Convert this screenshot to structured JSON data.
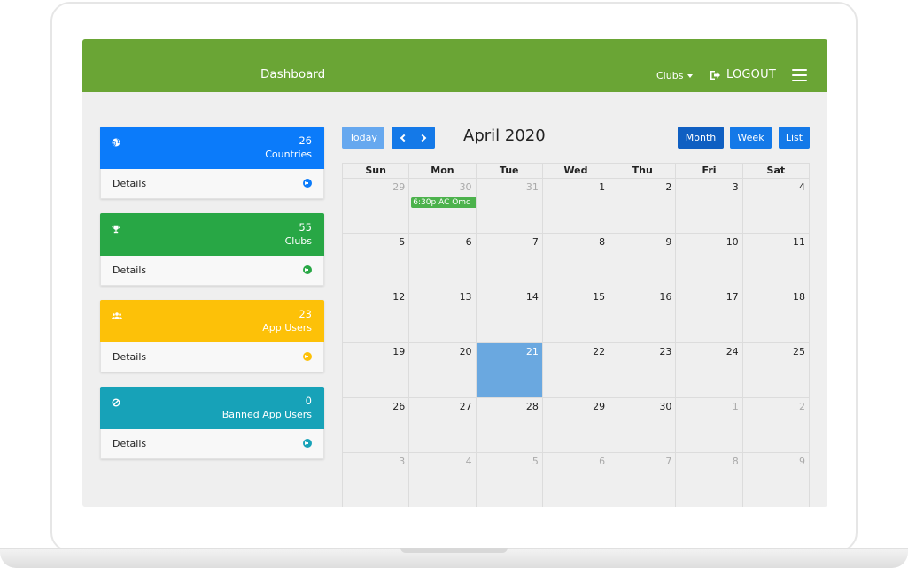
{
  "navbar": {
    "title": "Dashboard",
    "clubs_label": "Clubs",
    "logout_label": "LOGOUT",
    "color": "#6aa535"
  },
  "stats": [
    {
      "count": "26",
      "label": "Countries",
      "details": "Details",
      "icon": "globe-icon",
      "color": "#0b7bfa"
    },
    {
      "count": "55",
      "label": "Clubs",
      "details": "Details",
      "icon": "trophy-icon",
      "color": "#28a745"
    },
    {
      "count": "23",
      "label": "App Users",
      "details": "Details",
      "icon": "users-icon",
      "color": "#fdc108"
    },
    {
      "count": "0",
      "label": "Banned App Users",
      "details": "Details",
      "icon": "ban-icon",
      "color": "#17a2b8"
    }
  ],
  "calendar": {
    "today_label": "Today",
    "title": "April 2020",
    "views": {
      "month": "Month",
      "week": "Week",
      "list": "List"
    },
    "weekdays": [
      "Sun",
      "Mon",
      "Tue",
      "Wed",
      "Thu",
      "Fri",
      "Sat"
    ],
    "weeks": [
      [
        {
          "d": "29",
          "o": true
        },
        {
          "d": "30",
          "o": true
        },
        {
          "d": "31",
          "o": true
        },
        {
          "d": "1"
        },
        {
          "d": "2"
        },
        {
          "d": "3"
        },
        {
          "d": "4"
        }
      ],
      [
        {
          "d": "5"
        },
        {
          "d": "6"
        },
        {
          "d": "7"
        },
        {
          "d": "8"
        },
        {
          "d": "9"
        },
        {
          "d": "10"
        },
        {
          "d": "11"
        }
      ],
      [
        {
          "d": "12"
        },
        {
          "d": "13"
        },
        {
          "d": "14"
        },
        {
          "d": "15"
        },
        {
          "d": "16"
        },
        {
          "d": "17"
        },
        {
          "d": "18"
        }
      ],
      [
        {
          "d": "19"
        },
        {
          "d": "20"
        },
        {
          "d": "21",
          "today": true
        },
        {
          "d": "22"
        },
        {
          "d": "23"
        },
        {
          "d": "24"
        },
        {
          "d": "25"
        }
      ],
      [
        {
          "d": "26"
        },
        {
          "d": "27"
        },
        {
          "d": "28"
        },
        {
          "d": "29"
        },
        {
          "d": "30"
        },
        {
          "d": "1",
          "o": true
        },
        {
          "d": "2",
          "o": true
        }
      ],
      [
        {
          "d": "3",
          "o": true
        },
        {
          "d": "4",
          "o": true
        },
        {
          "d": "5",
          "o": true
        },
        {
          "d": "6",
          "o": true
        },
        {
          "d": "7",
          "o": true
        },
        {
          "d": "8",
          "o": true
        },
        {
          "d": "9",
          "o": true
        }
      ]
    ],
    "event": {
      "text": "6:30p AC Omc",
      "week": 0,
      "day": 1
    }
  }
}
